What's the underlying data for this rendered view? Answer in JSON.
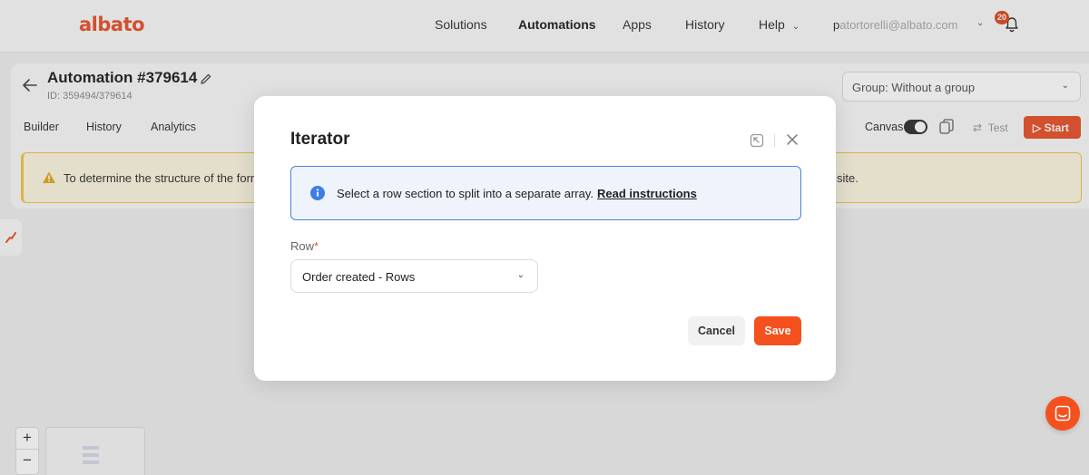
{
  "brand": {
    "logo_text": "albato",
    "accent_color": "#e8532b"
  },
  "topnav": {
    "items": [
      {
        "label": "Solutions",
        "active": false
      },
      {
        "label": "Automations",
        "active": true
      },
      {
        "label": "Apps",
        "active": false
      },
      {
        "label": "History",
        "active": false
      },
      {
        "label": "Help",
        "active": false,
        "has_dropdown": true
      }
    ],
    "user_email_first": "p",
    "user_email_rest": "atortorelli@albato.com",
    "notification_count": "20",
    "bell_icon": "bell-icon"
  },
  "automation": {
    "title": "Automation #379614",
    "id_text": "ID: 359494/379614",
    "group_select": "Group: Without a group",
    "tabs": [
      "Builder",
      "History",
      "Analytics"
    ],
    "canvas_label": "Canvas",
    "canvas_on": true,
    "test_label": "Test",
    "start_label": "Start"
  },
  "warning": {
    "text_start": "To determine the structure of the form",
    "text_end": "site."
  },
  "zoom": {
    "in_label": "+",
    "out_label": "−"
  },
  "modal": {
    "title": "Iterator",
    "info_text": "Select a row section to split into a separate array.",
    "info_link": "Read instructions",
    "info_color": "#4b82e3",
    "field_label": "Row",
    "required_mark": "*",
    "field_value": "Order created - Rows",
    "cancel_label": "Cancel",
    "save_label": "Save",
    "save_color": "#f4511e"
  }
}
